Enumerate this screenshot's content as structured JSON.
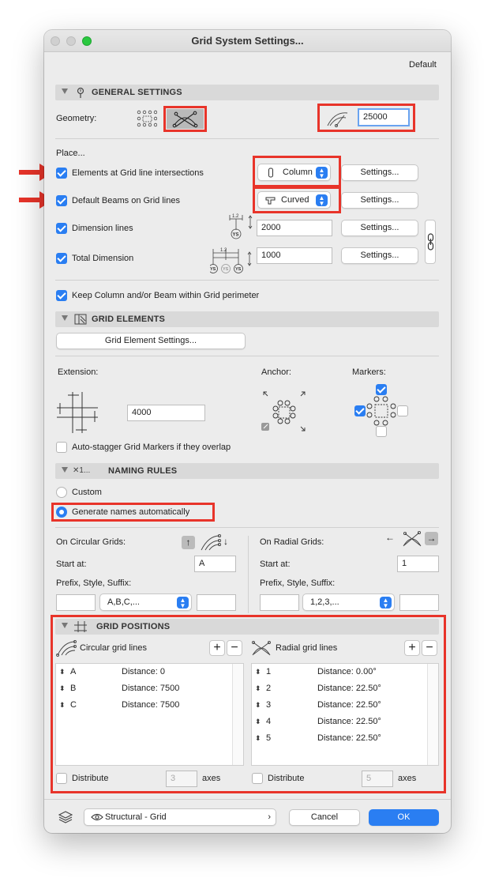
{
  "window": {
    "title": "Grid System Settings...",
    "favorite": "Default"
  },
  "colors": {
    "accent": "#2a7ef2",
    "annotation": "#e8342a"
  },
  "general": {
    "title": "GENERAL SETTINGS",
    "geometry_label": "Geometry:",
    "radius_value": "25000",
    "place_label": "Place...",
    "rows": [
      {
        "label": "Elements at Grid line intersections",
        "checked": true,
        "popup": "Column",
        "settings": "Settings..."
      },
      {
        "label": "Default Beams on Grid lines",
        "checked": true,
        "popup": "Curved",
        "settings": "Settings..."
      },
      {
        "label": "Dimension lines",
        "checked": true,
        "value": "2000",
        "settings": "Settings...",
        "dim_tag": "1.2",
        "marker": "YS"
      },
      {
        "label": "Total Dimension",
        "checked": true,
        "value": "1000",
        "settings": "Settings...",
        "dim_tag": "1.2",
        "marker": "YS"
      }
    ],
    "keep_label": "Keep Column and/or Beam within Grid perimeter"
  },
  "elements": {
    "title": "GRID ELEMENTS",
    "settings_button": "Grid Element Settings...",
    "extension_label": "Extension:",
    "anchor_label": "Anchor:",
    "markers_label": "Markers:",
    "extension_value": "4000",
    "autostagger_label": "Auto-stagger Grid Markers if they overlap"
  },
  "naming": {
    "title": "NAMING RULES",
    "icon_text": "✕1...",
    "custom_label": "Custom",
    "auto_label": "Generate names automatically",
    "circular": {
      "title": "On Circular Grids:",
      "start_label": "Start at:",
      "start": "A",
      "prefix_label": "Prefix, Style, Suffix:",
      "style": "A,B,C,..."
    },
    "radial": {
      "title": "On Radial Grids:",
      "start_label": "Start at:",
      "start": "1",
      "prefix_label": "Prefix, Style, Suffix:",
      "style": "1,2,3,..."
    }
  },
  "positions": {
    "title": "GRID POSITIONS",
    "circular": {
      "title": "Circular grid lines",
      "rows": [
        {
          "name": "A",
          "distance": "Distance: 0"
        },
        {
          "name": "B",
          "distance": "Distance: 7500"
        },
        {
          "name": "C",
          "distance": "Distance: 7500"
        }
      ],
      "distribute_label": "Distribute",
      "axes_value": "3",
      "axes_label": "axes"
    },
    "radial": {
      "title": "Radial grid lines",
      "rows": [
        {
          "name": "1",
          "distance": "Distance: 0.00°"
        },
        {
          "name": "2",
          "distance": "Distance: 22.50°"
        },
        {
          "name": "3",
          "distance": "Distance: 22.50°"
        },
        {
          "name": "4",
          "distance": "Distance: 22.50°"
        },
        {
          "name": "5",
          "distance": "Distance: 22.50°"
        }
      ],
      "distribute_label": "Distribute",
      "axes_value": "5",
      "axes_label": "axes"
    }
  },
  "footer": {
    "layer": "Structural - Grid",
    "cancel": "Cancel",
    "ok": "OK"
  }
}
